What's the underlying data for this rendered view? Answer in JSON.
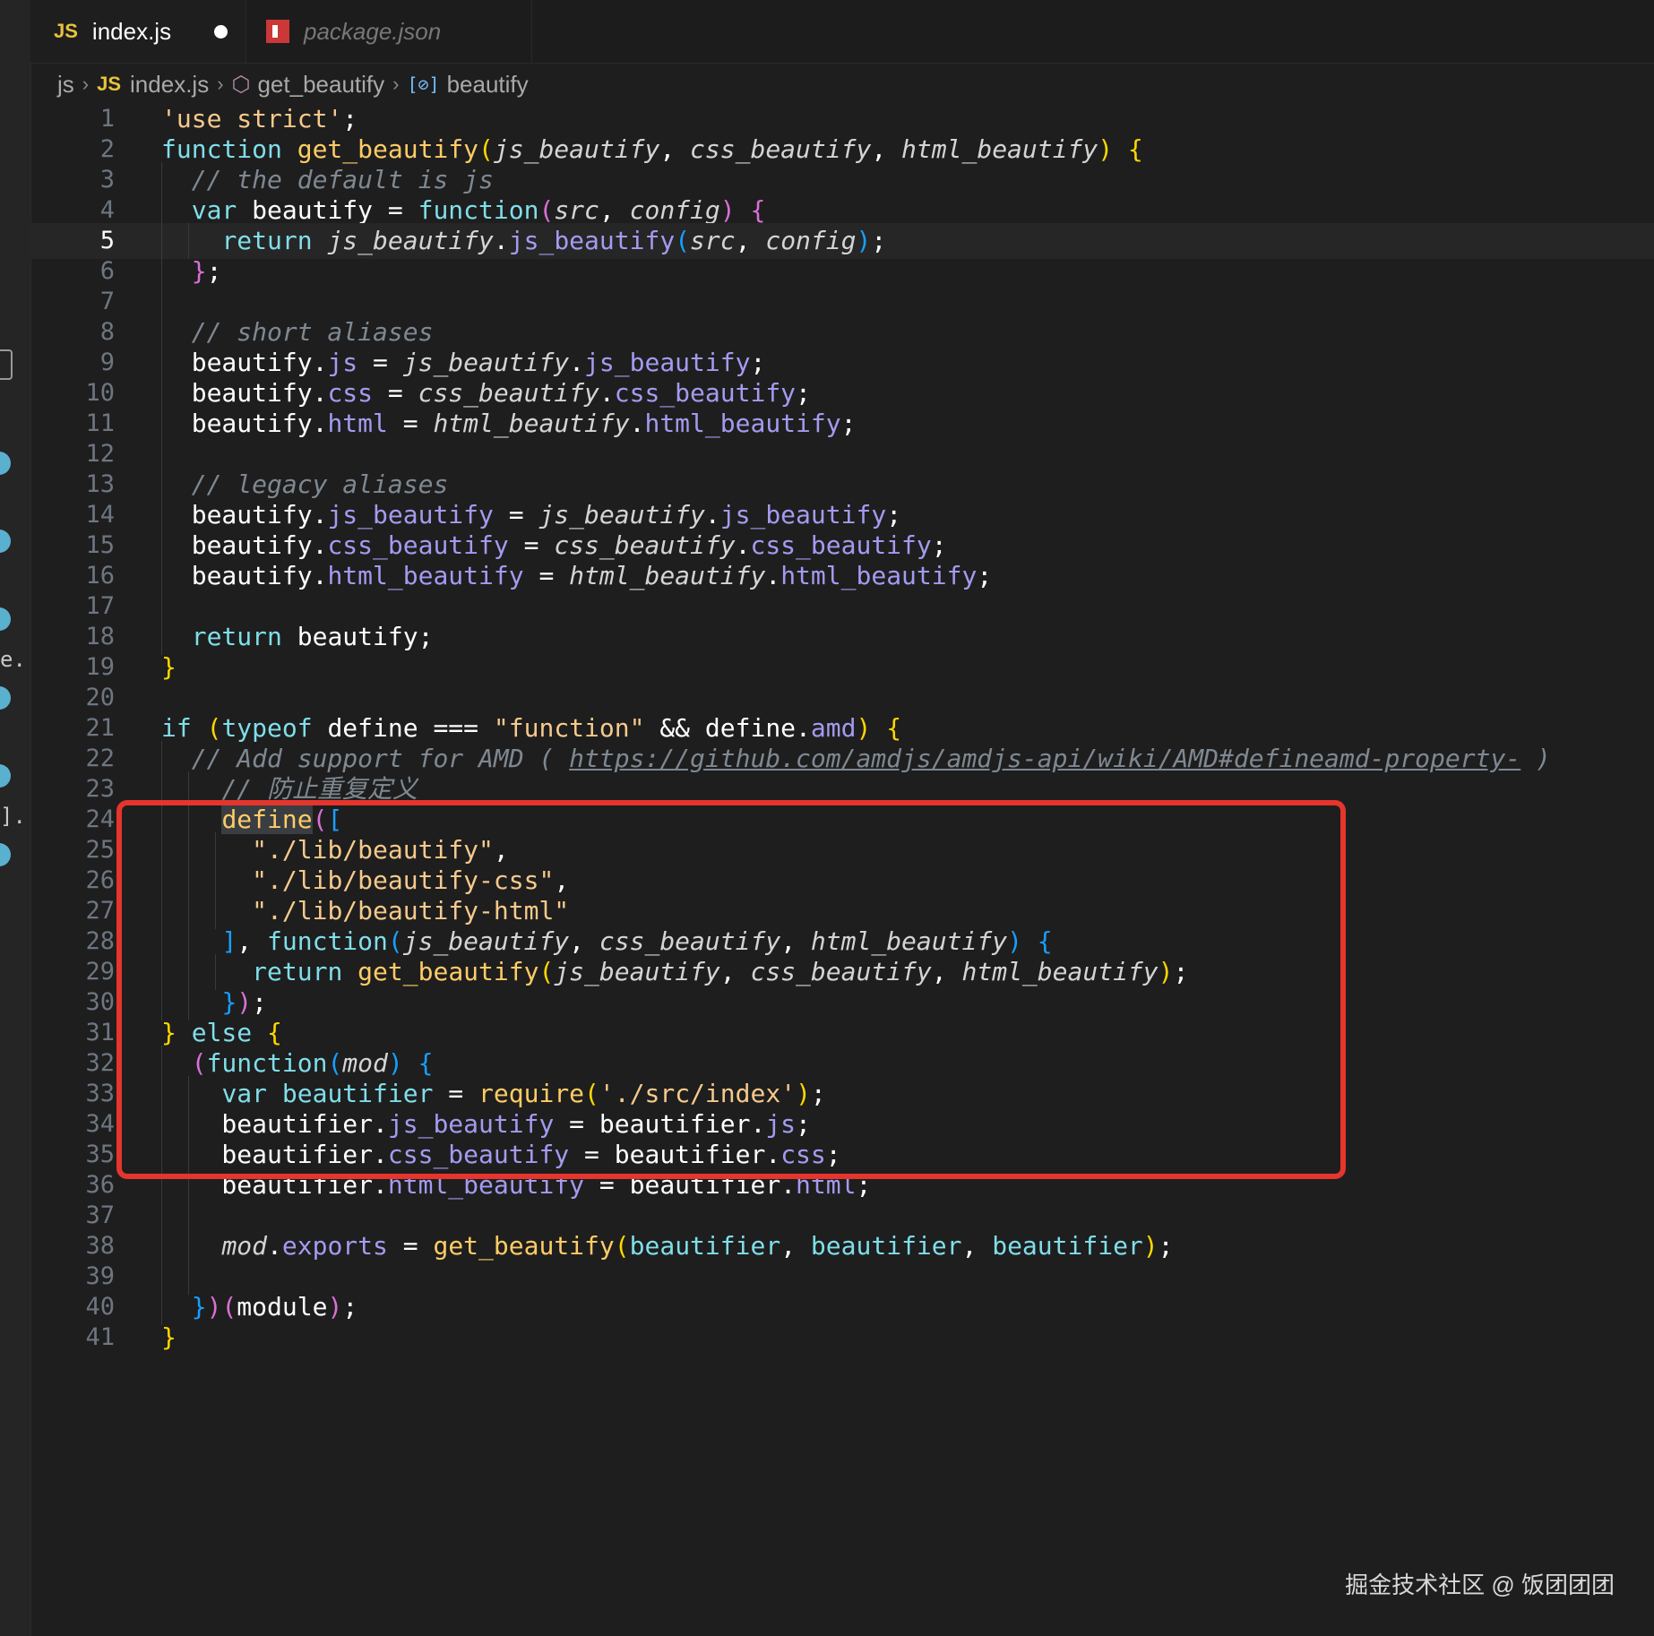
{
  "tabs": [
    {
      "icon": "JS",
      "label": "index.js",
      "dirty": true
    },
    {
      "icon": "npm",
      "label": "package.json"
    }
  ],
  "breadcrumb": {
    "folder": "js",
    "file_icon": "JS",
    "file": "index.js",
    "function": "get_beautify",
    "variable": "beautify"
  },
  "editor": {
    "current_line": "5",
    "lines": [
      {
        "num": "1",
        "text": "'use strict';"
      },
      {
        "num": "2",
        "text": "function get_beautify(js_beautify, css_beautify, html_beautify) {"
      },
      {
        "num": "3",
        "text": "  // the default is js"
      },
      {
        "num": "4",
        "text": "  var beautify = function(src, config) {"
      },
      {
        "num": "5",
        "text": "    return js_beautify.js_beautify(src, config);"
      },
      {
        "num": "6",
        "text": "  };"
      },
      {
        "num": "7",
        "text": ""
      },
      {
        "num": "8",
        "text": "  // short aliases"
      },
      {
        "num": "9",
        "text": "  beautify.js = js_beautify.js_beautify;"
      },
      {
        "num": "10",
        "text": "  beautify.css = css_beautify.css_beautify;"
      },
      {
        "num": "11",
        "text": "  beautify.html = html_beautify.html_beautify;"
      },
      {
        "num": "12",
        "text": ""
      },
      {
        "num": "13",
        "text": "  // legacy aliases"
      },
      {
        "num": "14",
        "text": "  beautify.js_beautify = js_beautify.js_beautify;"
      },
      {
        "num": "15",
        "text": "  beautify.css_beautify = css_beautify.css_beautify;"
      },
      {
        "num": "16",
        "text": "  beautify.html_beautify = html_beautify.html_beautify;"
      },
      {
        "num": "17",
        "text": ""
      },
      {
        "num": "18",
        "text": "  return beautify;"
      },
      {
        "num": "19",
        "text": "}"
      },
      {
        "num": "20",
        "text": ""
      },
      {
        "num": "21",
        "text": "if (typeof define === \"function\" && define.amd) {"
      },
      {
        "num": "22",
        "text": "  // Add support for AMD ( https://github.com/amdjs/amdjs-api/wiki/AMD#defineamd-property- )"
      },
      {
        "num": "23",
        "text": "    // 防止重复定义"
      },
      {
        "num": "24",
        "text": "    define(["
      },
      {
        "num": "25",
        "text": "      \"./lib/beautify\","
      },
      {
        "num": "26",
        "text": "      \"./lib/beautify-css\","
      },
      {
        "num": "27",
        "text": "      \"./lib/beautify-html\""
      },
      {
        "num": "28",
        "text": "    ], function(js_beautify, css_beautify, html_beautify) {"
      },
      {
        "num": "29",
        "text": "      return get_beautify(js_beautify, css_beautify, html_beautify);"
      },
      {
        "num": "30",
        "text": "    });"
      },
      {
        "num": "31",
        "text": "} else {"
      },
      {
        "num": "32",
        "text": "  (function(mod) {"
      },
      {
        "num": "33",
        "text": "    var beautifier = require('./src/index');"
      },
      {
        "num": "34",
        "text": "    beautifier.js_beautify = beautifier.js;"
      },
      {
        "num": "35",
        "text": "    beautifier.css_beautify = beautifier.css;"
      },
      {
        "num": "36",
        "text": "    beautifier.html_beautify = beautifier.html;"
      },
      {
        "num": "37",
        "text": ""
      },
      {
        "num": "38",
        "text": "    mod.exports = get_beautify(beautifier, beautifier, beautifier);"
      },
      {
        "num": "39",
        "text": ""
      },
      {
        "num": "40",
        "text": "  })(module);"
      },
      {
        "num": "41",
        "text": "}"
      }
    ]
  },
  "sidebar_fragments": [
    "e...",
    "]..."
  ],
  "watermark": "掘金技术社区 @ 饭团团团",
  "colors": {
    "background": "#1e1e1e",
    "keyword": "#80deea",
    "function_name": "#ffcc66",
    "string": "#f6c98c",
    "property": "#a39bf0",
    "comment": "#7f8891",
    "highlight_box": "#e5352c"
  }
}
